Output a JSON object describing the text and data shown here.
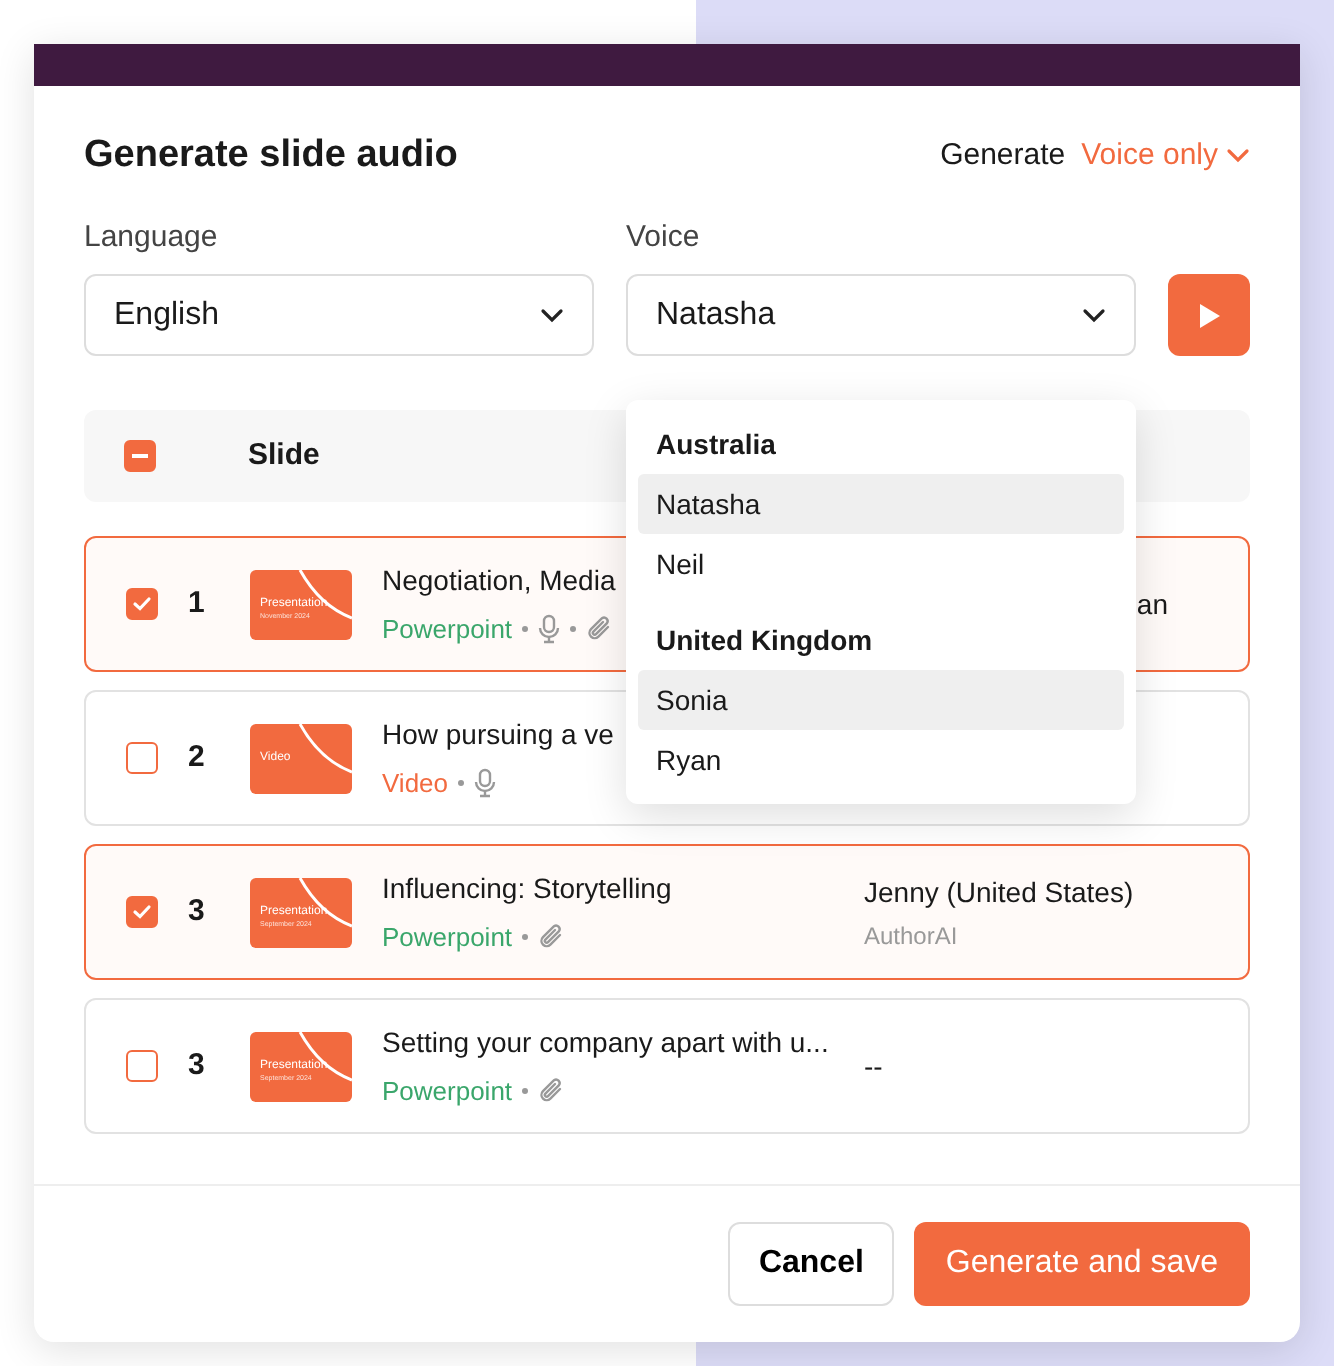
{
  "dialog": {
    "title": "Generate slide audio",
    "generate_label": "Generate",
    "generate_mode": "Voice only"
  },
  "language": {
    "label": "Language",
    "value": "English"
  },
  "voice": {
    "label": "Voice",
    "value": "Natasha"
  },
  "table": {
    "header": {
      "indeterminate": true,
      "column": "Slide"
    },
    "rows": [
      {
        "checked": true,
        "number": "1",
        "thumb_title": "Presentation",
        "thumb_date": "November 2024",
        "title": "Negotiation, Media",
        "type": "Powerpoint",
        "kind": "powerpoint",
        "mic": true,
        "attachment": true,
        "voice": "an",
        "voice_clipped": true
      },
      {
        "checked": false,
        "number": "2",
        "thumb_title": "Video",
        "title": "How pursuing a ve",
        "type": "Video",
        "kind": "video",
        "mic": true,
        "attachment": false
      },
      {
        "checked": true,
        "number": "3",
        "thumb_title": "Presentation",
        "thumb_date": "September 2024",
        "title": "Influencing: Storytelling",
        "type": "Powerpoint",
        "kind": "powerpoint",
        "mic": false,
        "attachment": true,
        "voice": "Jenny (United States)",
        "voice_source": "AuthorAI"
      },
      {
        "checked": false,
        "number": "3",
        "thumb_title": "Presentation",
        "thumb_date": "September 2024",
        "title": "Setting your company apart with u...",
        "type": "Powerpoint",
        "kind": "powerpoint",
        "mic": false,
        "attachment": true,
        "voice": "--"
      }
    ]
  },
  "voice_menu": [
    {
      "kind": "group",
      "label": "Australia"
    },
    {
      "kind": "option",
      "label": "Natasha",
      "highlighted": true
    },
    {
      "kind": "option",
      "label": "Neil",
      "highlighted": false
    },
    {
      "kind": "group",
      "label": "United Kingdom"
    },
    {
      "kind": "option",
      "label": "Sonia",
      "highlighted": true
    },
    {
      "kind": "option",
      "label": "Ryan",
      "highlighted": false
    }
  ],
  "buttons": {
    "cancel": "Cancel",
    "save": "Generate and save"
  }
}
